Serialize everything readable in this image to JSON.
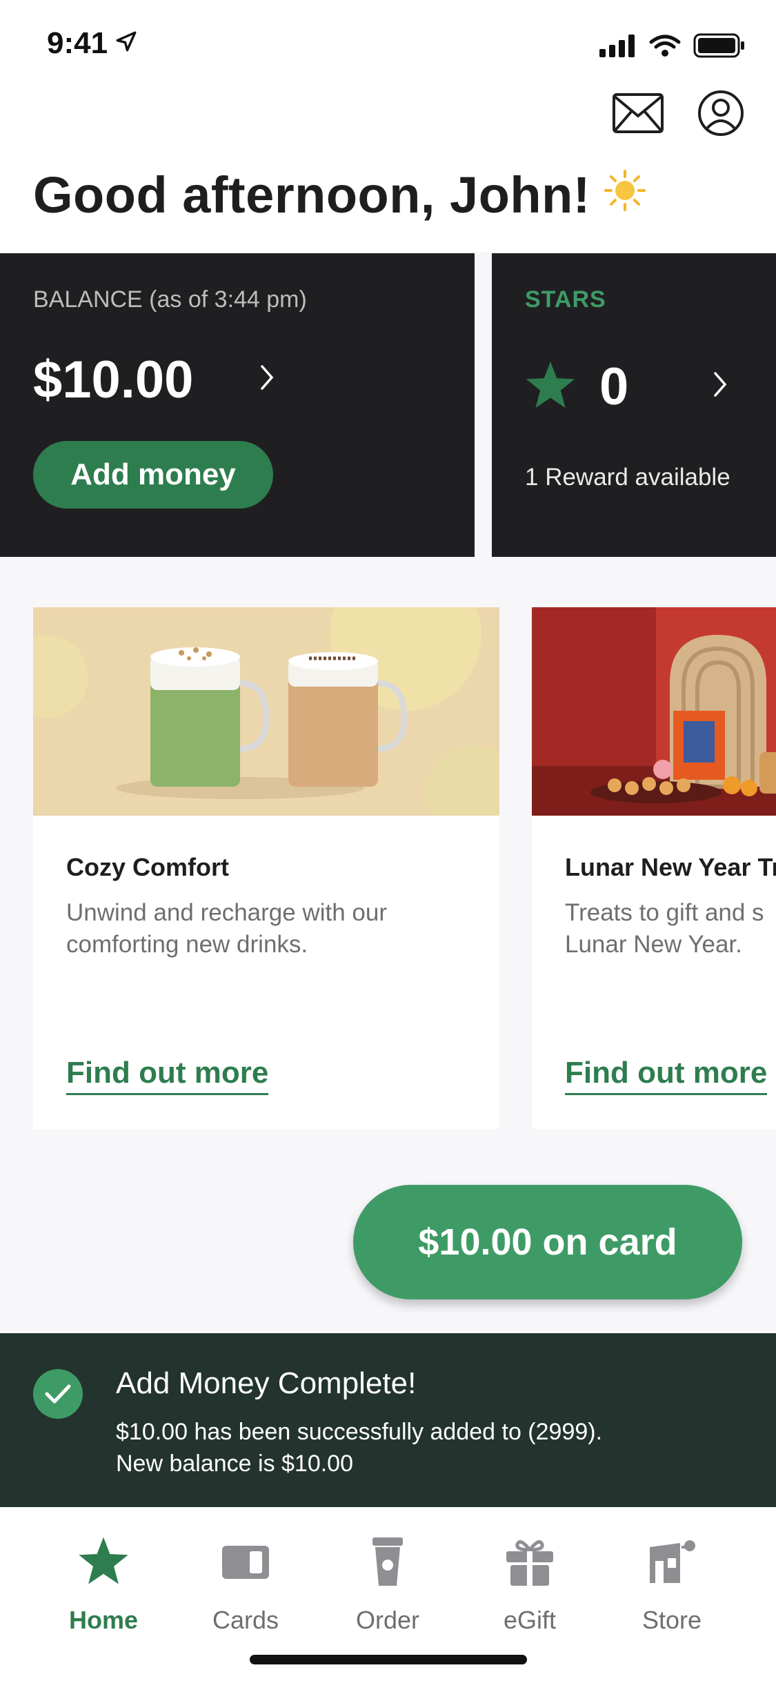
{
  "status_bar": {
    "time": "9:41"
  },
  "header": {
    "greeting": "Good afternoon, John!"
  },
  "balance": {
    "label": "BALANCE (as of 3:44 pm)",
    "amount": "$10.00",
    "add_money_label": "Add money"
  },
  "stars": {
    "label": "STARS",
    "count": "0",
    "reward_text": "1 Reward available"
  },
  "promos": [
    {
      "title": "Cozy Comfort",
      "description": "Unwind and recharge with our comforting new drinks.",
      "link": "Find out more"
    },
    {
      "title": "Lunar New Year Tr",
      "description_line1": "Treats to gift and s",
      "description_line2": "Lunar New Year.",
      "link": "Find out more"
    }
  ],
  "card_button": {
    "label": "$10.00 on card"
  },
  "toast": {
    "title": "Add Money Complete!",
    "message_line1": "$10.00 has been successfully added to  (2999).",
    "message_line2": "New balance is $10.00"
  },
  "tabs": [
    {
      "label": "Home",
      "icon": "star-icon",
      "active": true
    },
    {
      "label": "Cards",
      "icon": "card-icon",
      "active": false
    },
    {
      "label": "Order",
      "icon": "cup-icon",
      "active": false
    },
    {
      "label": "eGift",
      "icon": "gift-icon",
      "active": false
    },
    {
      "label": "Store",
      "icon": "store-icon",
      "active": false
    }
  ],
  "colors": {
    "brand_green": "#2e7d4f",
    "accent_green": "#3f9b66",
    "dark_card": "#1f1f22",
    "toast_bg": "#23332d"
  }
}
